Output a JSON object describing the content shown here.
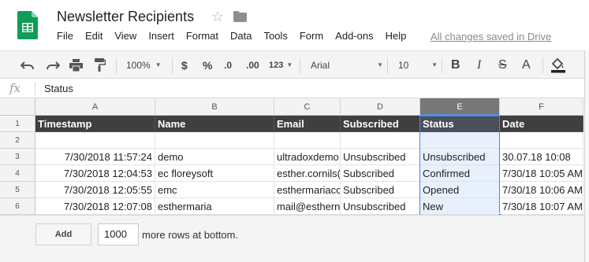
{
  "app": {
    "title": "Newsletter Recipients",
    "saved_status": "All changes saved in Drive",
    "brand_color": "#0f9d58"
  },
  "menu": [
    "File",
    "Edit",
    "View",
    "Insert",
    "Format",
    "Data",
    "Tools",
    "Form",
    "Add-ons",
    "Help"
  ],
  "toolbar": {
    "zoom": "100%",
    "currency": "$",
    "percent": "%",
    "decimal_less": ".0",
    "decimal_more": ".00",
    "number_format": "123",
    "font": "Arial",
    "font_size": "10",
    "bold": "B",
    "italic": "I",
    "strikethrough": "S",
    "text_color": "A",
    "icons": [
      "undo-icon",
      "redo-icon",
      "print-icon",
      "paint-format-icon",
      "fill-color-icon"
    ]
  },
  "formula_bar": {
    "label": "fx",
    "value": "Status"
  },
  "grid": {
    "columns": [
      "A",
      "B",
      "C",
      "D",
      "E",
      "F"
    ],
    "selected_column": "E",
    "row_numbers": [
      "1",
      "2",
      "3",
      "4",
      "5",
      "6"
    ],
    "rows": [
      [
        "Timestamp",
        "Name",
        "Email",
        "Subscribed",
        "Status",
        "Date"
      ],
      [
        "",
        "",
        "",
        "",
        "",
        ""
      ],
      [
        "7/30/2018 11:57:24",
        "demo",
        "ultradoxdemo.",
        "Unsubscribed",
        "Unsubscribed",
        "30.07.18 10:08"
      ],
      [
        "7/30/2018 12:04:53",
        "ec floreysoft",
        "esther.cornils(",
        "Subscribed",
        "Confirmed",
        "7/30/18 10:05 AM"
      ],
      [
        "7/30/2018 12:05:55",
        "emc",
        "esthermariacc",
        "Subscribed",
        "Opened",
        "7/30/18 10:06 AM"
      ],
      [
        "7/30/2018 12:07:08",
        "esthermaria",
        "mail@esthern",
        "Unsubscribed",
        "New",
        "7/30/18 10:07 AM"
      ]
    ]
  },
  "bottom": {
    "add_label": "Add",
    "rows_value": "1000",
    "rows_text": "more rows at bottom."
  }
}
